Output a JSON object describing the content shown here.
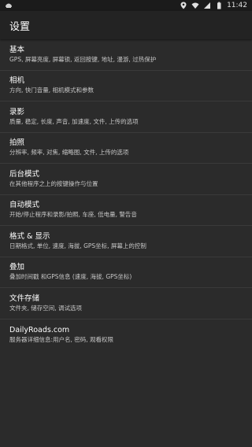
{
  "status_bar": {
    "time": "11:42",
    "icons": [
      "android-notification-icon",
      "location-icon",
      "wifi-icon",
      "signal-icon",
      "battery-icon"
    ]
  },
  "app_bar": {
    "title": "设置"
  },
  "settings": [
    {
      "title": "基本",
      "summary": "GPS, 屏幕亮度, 屏幕锁, 返回按键, 地址, 漫游, 过热保护"
    },
    {
      "title": "相机",
      "summary": "方向, 快门音量, 相机模式和参数"
    },
    {
      "title": "录影",
      "summary": "质量, 稳定, 长度, 声音, 加速度, 文件, 上传的选项"
    },
    {
      "title": "拍照",
      "summary": "分辨率, 频率, 对焦, 缩略图, 文件, 上传的选项"
    },
    {
      "title": "后台模式",
      "summary": "在其他程序之上的按键操作与位置"
    },
    {
      "title": "自动模式",
      "summary": "开始/停止程序和录影/拍照, 车座, 低电量, 警告音"
    },
    {
      "title": "格式 & 显示",
      "summary": "日期格式, 单位, 速度, 海拔, GPS坐标, 屏幕上的控制"
    },
    {
      "title": "叠加",
      "summary": "叠加时间戳 和GPS信息 (速度, 海拔, GPS坐标)"
    },
    {
      "title": "文件存储",
      "summary": "文件夹, 储存空间, 调试选项"
    },
    {
      "title": "DailyRoads.com",
      "summary": "服务器详细信息:用户名, 密码, 观看权限"
    }
  ]
}
